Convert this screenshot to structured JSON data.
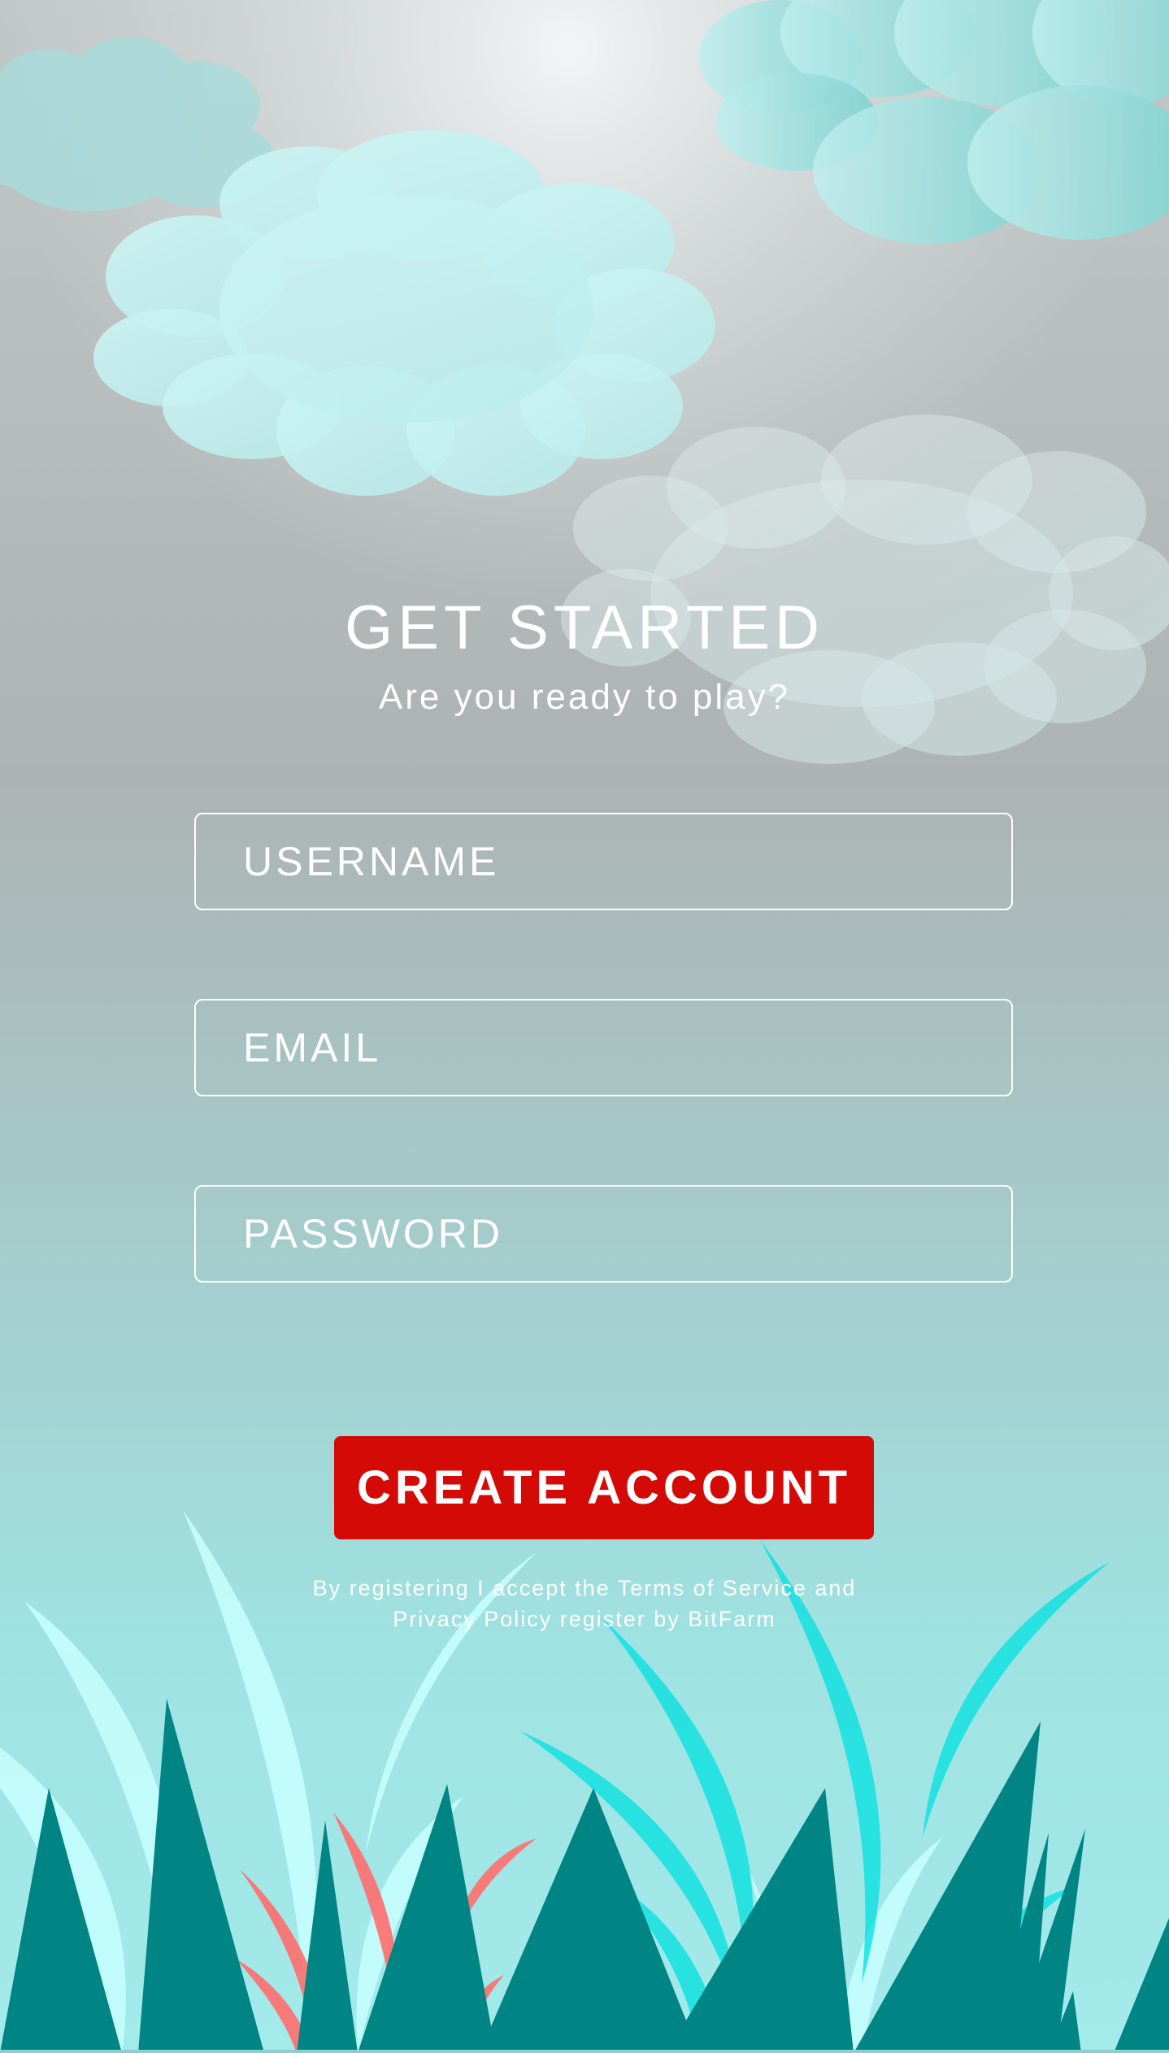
{
  "header": {
    "title": "GET STARTED",
    "subtitle": "Are you ready to play?"
  },
  "form": {
    "username_placeholder": "USERNAME",
    "email_placeholder": "EMAIL",
    "password_placeholder": "PASSWORD",
    "username_value": "",
    "email_value": "",
    "password_value": ""
  },
  "actions": {
    "create_account_label": "CREATE ACCOUNT"
  },
  "legal": {
    "text": "By registering I accept the Terms of Service and Privacy Policy register by BitFarm"
  },
  "colors": {
    "sky_top": "#eef2f2",
    "sky_mid": "#aeb6b6",
    "ground": "#9ee6e6",
    "cloud": "#c6f1f1",
    "button": "#d40a07",
    "grass_dark": "#008080",
    "grass_cyan": "#00e6e6",
    "grass_light": "#c8ffff",
    "grass_red": "#ff6e6e"
  }
}
